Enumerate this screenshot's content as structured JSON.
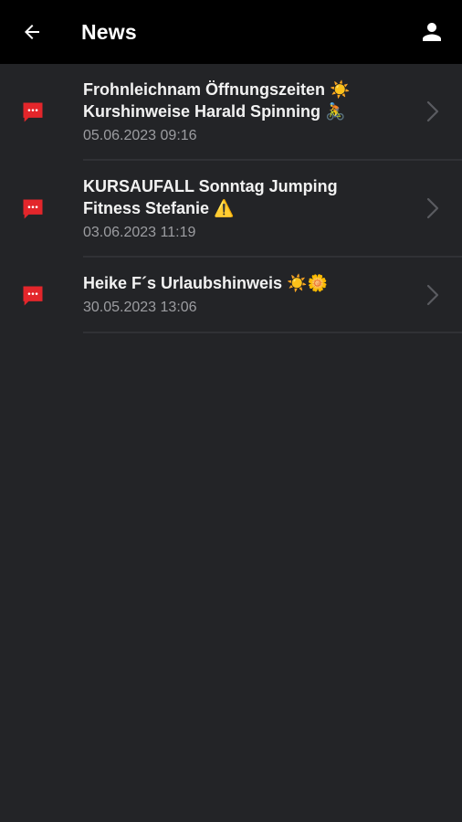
{
  "header": {
    "title": "News",
    "back_icon": "arrow-left-icon",
    "profile_icon": "person-icon"
  },
  "colors": {
    "appbar": "#000000",
    "background": "#232427",
    "accent": "#e3262b",
    "date_text": "#9c9da1",
    "divider": "#303135"
  },
  "news": [
    {
      "line1": "Frohnleichnam Öffnungszeiten ☀️",
      "line2": "Kurshinweise Harald Spinning 🚴",
      "date": "05.06.2023 09:16",
      "icon": "message-icon"
    },
    {
      "line1": "KURSAUFALL Sonntag Jumping",
      "line2": "Fitness Stefanie ⚠️",
      "date": "03.06.2023 11:19",
      "icon": "message-icon"
    },
    {
      "line1": "Heike F´s Urlaubshinweis ☀️🌼",
      "line2": "",
      "date": "30.05.2023 13:06",
      "icon": "message-icon"
    }
  ]
}
